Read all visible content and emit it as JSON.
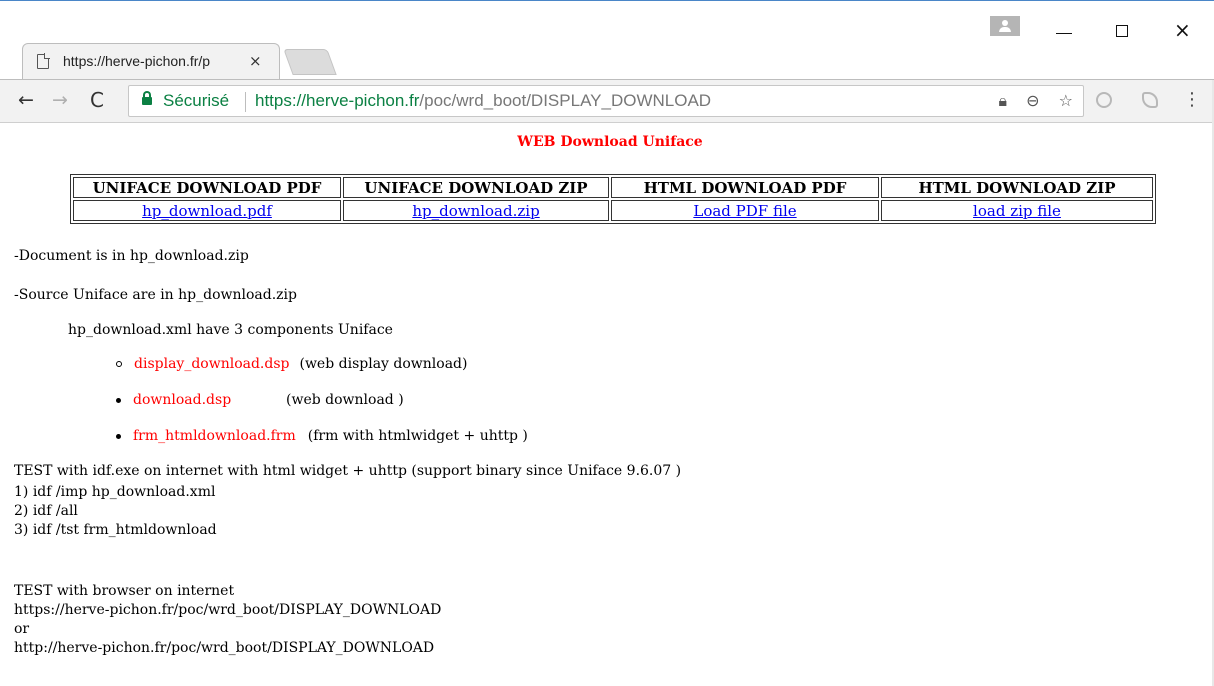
{
  "browser": {
    "tab_title": "https://herve-pichon.fr/p",
    "tab_close": "×",
    "secure_label": "Sécurisé",
    "url_host": "https://herve-pichon.fr",
    "url_path": "/poc/wrd_boot/DISPLAY_DOWNLOAD",
    "nav": {
      "back": "←",
      "forward": "→",
      "reload": "C"
    },
    "window": {
      "close": "×"
    },
    "menu": "⋮",
    "omni": {
      "zoom": "⊖",
      "star": "☆"
    }
  },
  "page": {
    "title": "WEB Download Uniface",
    "table": {
      "headers": [
        "UNIFACE DOWNLOAD PDF",
        "UNIFACE DOWNLOAD ZIP",
        "HTML DOWNLOAD PDF",
        "HTML DOWNLOAD ZIP"
      ],
      "links": [
        "hp_download.pdf",
        "hp_download.zip",
        "Load PDF file",
        "load zip file"
      ]
    },
    "doc_line": "-Document is in  hp_download.zip",
    "source_line": "-Source Uniface are in  hp_download.zip",
    "components_line": "hp_download.xml have 3 components Uniface",
    "components": [
      {
        "name": "display_download.dsp",
        "desc": "(web display download)"
      },
      {
        "name": "download.dsp",
        "desc": "(web download )"
      },
      {
        "name": "frm_htmldownload.frm",
        "desc": "(frm with htmlwidget + uhttp )"
      }
    ],
    "test_idf": [
      "TEST with idf.exe on internet   with html widget + uhttp (support binary since Uniface 9.6.07 )",
      "1) idf /imp hp_download.xml",
      "2) idf /all",
      "3) idf /tst frm_htmldownload"
    ],
    "test_browser": [
      "TEST with browser on internet",
      "https://herve-pichon.fr/poc/wrd_boot/DISPLAY_DOWNLOAD",
      "or",
      "http://herve-pichon.fr/poc/wrd_boot/DISPLAY_DOWNLOAD"
    ]
  }
}
